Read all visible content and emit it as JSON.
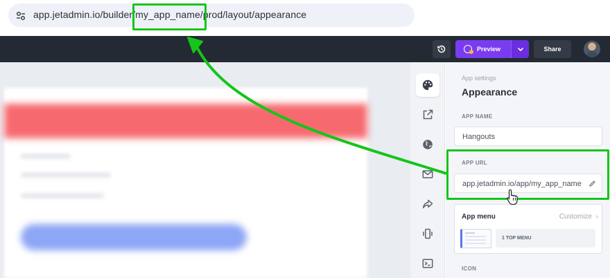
{
  "browser": {
    "url_prefix": "app.jetadmin.io/builder/",
    "url_highlight": "my_app_name",
    "url_suffix": "/prod/layout/appearance"
  },
  "topbar": {
    "preview_label": "Preview",
    "share_label": "Share"
  },
  "panel": {
    "kicker": "App settings",
    "title": "Appearance",
    "app_name_label": "APP NAME",
    "app_name_value": "Hangouts",
    "app_url_label": "APP URL",
    "app_url_value": "app.jetadmin.io/app/my_app_name",
    "app_menu_title": "App menu",
    "customize_label": "Customize",
    "menu_option_label": "1 TOP MENU",
    "icon_label": "ICON"
  },
  "rail": {
    "icons": [
      "palette-icon",
      "external-link-icon",
      "globe-icon",
      "mail-icon",
      "share-arrow-icon",
      "mobile-vibrate-icon",
      "terminal-icon"
    ]
  },
  "colors": {
    "topbar": "#242a33",
    "preview": "#7a3cf0",
    "annotation": "#14c51a"
  }
}
